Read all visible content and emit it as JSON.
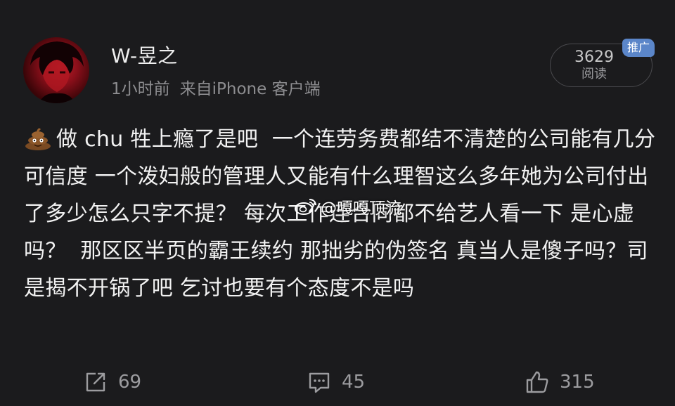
{
  "user": {
    "name": "W-昱之",
    "time": "1小时前",
    "source": "来自iPhone 客户端"
  },
  "reads": {
    "count": "3629",
    "label": "阅读",
    "tag": "推广"
  },
  "post": {
    "emoji": "poop-icon",
    "text": "做 chu 牲上瘾了是吧  一个连劳务费都结不清楚的公司能有几分可信度 一个泼妇般的管理人又能有什么理智这么多年她为公司付出了多少怎么只字不提？ 每次工作连合同都不给艺人看一下 是心虚吗？  那区区半页的霸王续约 那拙劣的伪签名 真当人是傻子吗？司是揭不开锅了吧 乞讨也要有个态度不是吗"
  },
  "watermark": {
    "text": "@嘎嘎顶流",
    "icon": "weibo-icon"
  },
  "actions": {
    "repost": "69",
    "comment": "45",
    "like": "315"
  },
  "colors": {
    "background": "#1b1b1d",
    "text": "#f2f2f2",
    "muted": "#8d8d90",
    "tag": "#5b86c9"
  }
}
